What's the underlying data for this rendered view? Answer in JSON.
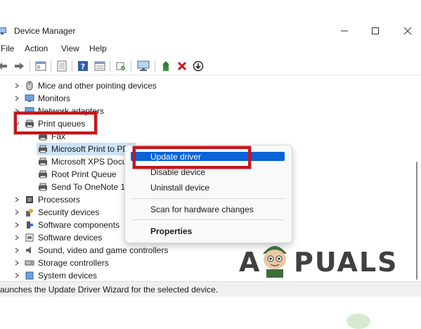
{
  "window": {
    "title": "Device Manager"
  },
  "menu": {
    "items": [
      "File",
      "Action",
      "View",
      "Help"
    ]
  },
  "toolbar": {
    "buttons": [
      "back",
      "forward",
      "properties-sheet",
      "show-hide",
      "help",
      "view-resources",
      "scan-hardware",
      "monitor",
      "update-driver",
      "uninstall",
      "disable"
    ]
  },
  "tree": {
    "mice": "Mice and other pointing devices",
    "monitors": "Monitors",
    "network": "Network adapters",
    "print_queues": "Print queues",
    "fax": "Fax",
    "ms_print_pdf": "Microsoft Print to PDF",
    "ms_xps": "Microsoft XPS Document Writer",
    "root_print": "Root Print Queue",
    "onenote": "Send To OneNote 16",
    "processors": "Processors",
    "security": "Security devices",
    "software_components": "Software components",
    "software_devices": "Software devices",
    "sound": "Sound, video and game controllers",
    "storage": "Storage controllers",
    "system": "System devices"
  },
  "context_menu": {
    "update_driver": "Update driver",
    "disable_device": "Disable device",
    "uninstall_device": "Uninstall device",
    "scan_hardware": "Scan for hardware changes",
    "properties": "Properties"
  },
  "status": {
    "text": "aunches the Update Driver Wizard for the selected device."
  },
  "watermark": {
    "left": "A",
    "right": "PUALS"
  },
  "colors": {
    "accent": "#0a63d6",
    "highlight_box": "#c8141a",
    "selected_row": "#cde3f7"
  }
}
